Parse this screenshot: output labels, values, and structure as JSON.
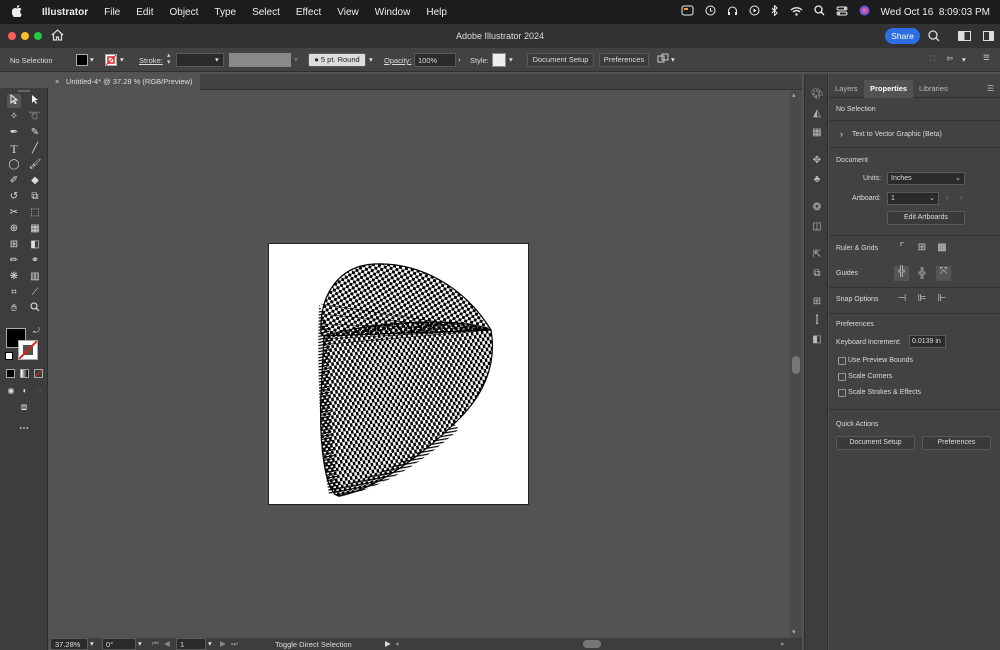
{
  "menubar": {
    "apple": "",
    "app_name": "Illustrator",
    "items": [
      "File",
      "Edit",
      "Object",
      "Type",
      "Select",
      "Effect",
      "View",
      "Window",
      "Help"
    ],
    "datetime": "Wed Oct 16  8:09:03 PM",
    "status_icons": [
      "notification-icon",
      "time-machine-icon",
      "headphones-icon",
      "play-icon",
      "bluetooth-icon",
      "wifi-icon",
      "spotlight-search-icon",
      "control-center-icon",
      "siri-icon"
    ]
  },
  "window": {
    "title": "Adobe Illustrator 2024",
    "share_label": "Share",
    "colors": {
      "share": "#2d6ee5",
      "close": "#ff5f57",
      "minimize": "#febc2e",
      "zoom": "#28c840"
    }
  },
  "control_bar": {
    "selection": "No Selection",
    "stroke_label": "Stroke:",
    "brush": "5 pt. Round",
    "opacity_label": "Opacity:",
    "opacity_value": "100%",
    "style_label": "Style:",
    "document_setup": "Document Setup",
    "preferences": "Preferences"
  },
  "document": {
    "tab_title": "Untitled-4* @ 37.28 % (RGB/Preview)",
    "close": "×"
  },
  "status": {
    "zoom": "37.28%",
    "rotation": "0°",
    "artboard": "1",
    "current_tool": "Toggle Direct Selection"
  },
  "panel": {
    "tabs": [
      "Layers",
      "Properties",
      "Libraries"
    ],
    "active_tab": "Properties",
    "selection": "No Selection",
    "text_to_vector": "Text to Vector Graphic (Beta)",
    "document_heading": "Document",
    "units_label": "Units:",
    "units_value": "Inches",
    "artboard_label": "Artboard:",
    "artboard_value": "1",
    "edit_artboards": "Edit Artboards",
    "ruler_grids": "Ruler & Grids",
    "guides": "Guides",
    "snap_options": "Snap Options",
    "preferences_heading": "Preferences",
    "keyboard_increment_label": "Keyboard Increment:",
    "keyboard_increment_value": "0.0139 in",
    "checkboxes": [
      "Use Preview Bounds",
      "Scale Corners",
      "Scale Strokes & Effects"
    ],
    "quick_actions": "Quick Actions",
    "document_setup": "Document Setup",
    "preferences_btn": "Preferences"
  }
}
